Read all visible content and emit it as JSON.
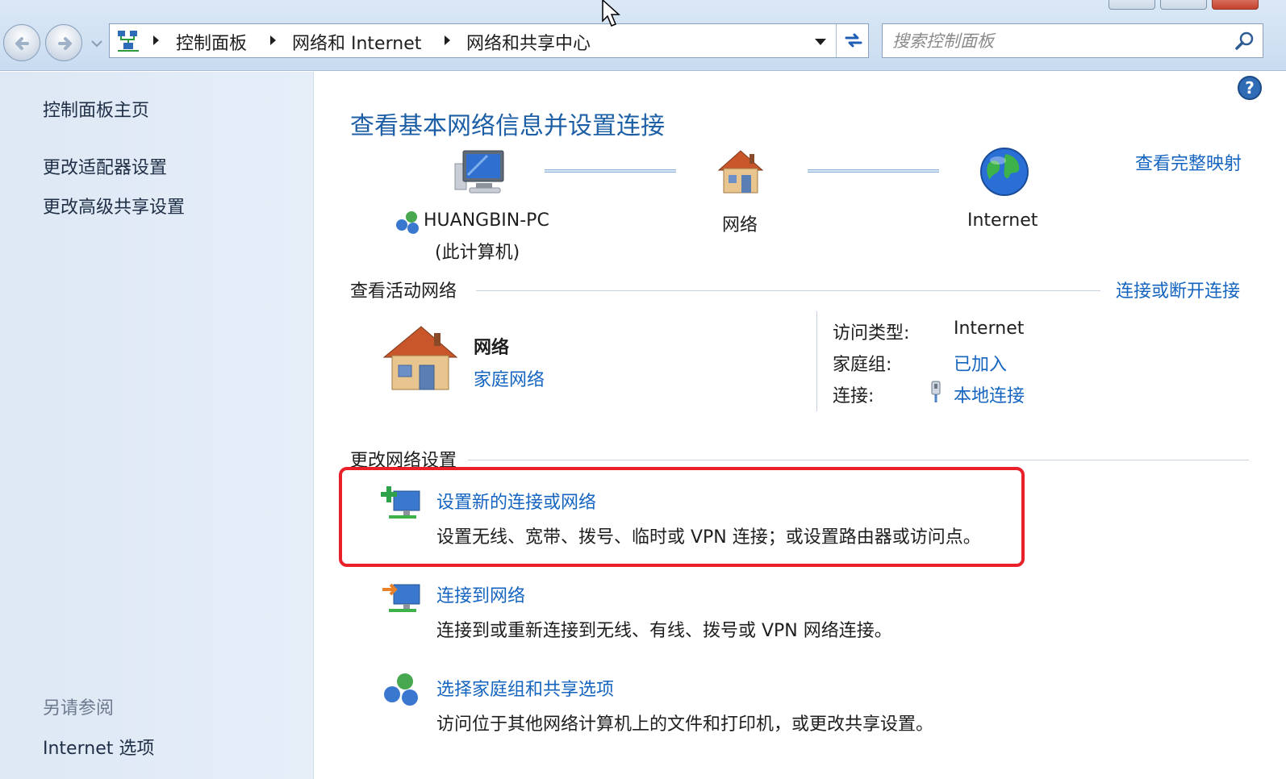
{
  "address_bar": {
    "breadcrumbs": [
      "控制面板",
      "网络和 Internet",
      "网络和共享中心"
    ],
    "search_placeholder": "搜索控制面板"
  },
  "sidebar": {
    "items": [
      "控制面板主页",
      "更改适配器设置",
      "更改高级共享设置"
    ],
    "see_also_header": "另请参阅",
    "see_also_items": [
      "Internet 选项"
    ]
  },
  "main": {
    "title": "查看基本网络信息并设置连接",
    "full_map_link": "查看完整映射",
    "map": {
      "computer_name": "HUANGBIN-PC",
      "computer_sub": "(此计算机)",
      "network": "网络",
      "internet": "Internet"
    },
    "active_networks": {
      "header": "查看活动网络",
      "connect_link": "连接或断开连接",
      "network_name": "网络",
      "network_type": "家庭网络",
      "access_type_label": "访问类型:",
      "access_type_value": "Internet",
      "homegroup_label": "家庭组:",
      "homegroup_value": "已加入",
      "connections_label": "连接:",
      "connections_value": "本地连接"
    },
    "change_settings": {
      "header": "更改网络设置",
      "tasks": [
        {
          "title": "设置新的连接或网络",
          "desc": "设置无线、宽带、拨号、临时或 VPN 连接；或设置路由器或访问点。",
          "icon": "new-connection-icon"
        },
        {
          "title": "连接到网络",
          "desc": "连接到或重新连接到无线、有线、拨号或 VPN 网络连接。",
          "icon": "connect-network-icon"
        },
        {
          "title": "选择家庭组和共享选项",
          "desc": "访问位于其他网络计算机上的文件和打印机，或更改共享设置。",
          "icon": "homegroup-icon"
        }
      ]
    }
  },
  "colors": {
    "link": "#1565c0",
    "title": "#1d5fa6",
    "highlight": "#e8202a",
    "sidebar_bg": "#dde8f4"
  }
}
